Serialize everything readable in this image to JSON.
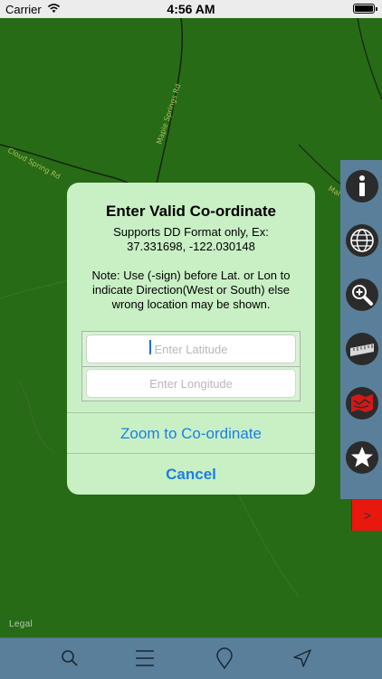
{
  "status_bar": {
    "carrier": "Carrier",
    "time": "4:56 AM"
  },
  "map": {
    "roads": [
      "Cloud Spring Rd",
      "Maple Springs Rd",
      "Mal"
    ],
    "legal": "Legal"
  },
  "dialog": {
    "title": "Enter Valid Co-ordinate",
    "format_note_line1": "Supports DD Format only, Ex:",
    "format_note_line2": "37.331698, -122.030148",
    "direction_note": "Note: Use (-sign) before Lat. or Lon to indicate Direction(West or South) else wrong location may be shown.",
    "latitude": {
      "value": "",
      "placeholder": "Enter Latitude"
    },
    "longitude": {
      "value": "",
      "placeholder": "Enter Longitude"
    },
    "zoom_label": "Zoom to Co-ordinate",
    "cancel_label": "Cancel"
  },
  "side_toolbar": {
    "items": [
      "info-icon",
      "globe-icon",
      "zoom-in-icon",
      "ruler-icon",
      "map-layer-icon",
      "star-icon"
    ],
    "expand_label": ">"
  },
  "bottom_bar": {
    "items": [
      "search-icon",
      "menu-icon",
      "location-pin-icon",
      "navigation-arrow-icon"
    ]
  },
  "colors": {
    "map_green": "#2d7a1a",
    "dialog_background": "#c9f0c5",
    "toolbar_background": "#5a7f9a",
    "action_blue": "#1c7fe2",
    "expand_red": "#e8180f"
  }
}
